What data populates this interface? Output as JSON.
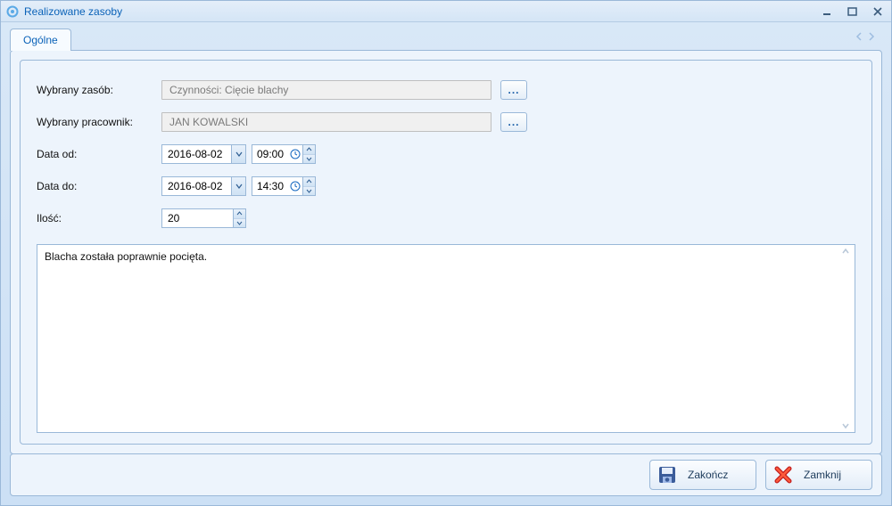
{
  "window": {
    "title": "Realizowane zasoby"
  },
  "tabs": {
    "active": "Ogólne"
  },
  "form": {
    "resource_label": "Wybrany zasób:",
    "resource_value": "Czynności: Cięcie blachy",
    "employee_label": "Wybrany pracownik:",
    "employee_value": "JAN KOWALSKI",
    "date_from_label": "Data od:",
    "date_from_value": "2016-08-02",
    "time_from_value": "09:00",
    "date_to_label": "Data do:",
    "date_to_value": "2016-08-02",
    "time_to_value": "14:30",
    "quantity_label": "Ilość:",
    "quantity_value": "20",
    "notes_value": "Blacha została poprawnie pocięta."
  },
  "buttons": {
    "finish": "Zakończ",
    "close": "Zamknij",
    "ellipsis": "..."
  }
}
